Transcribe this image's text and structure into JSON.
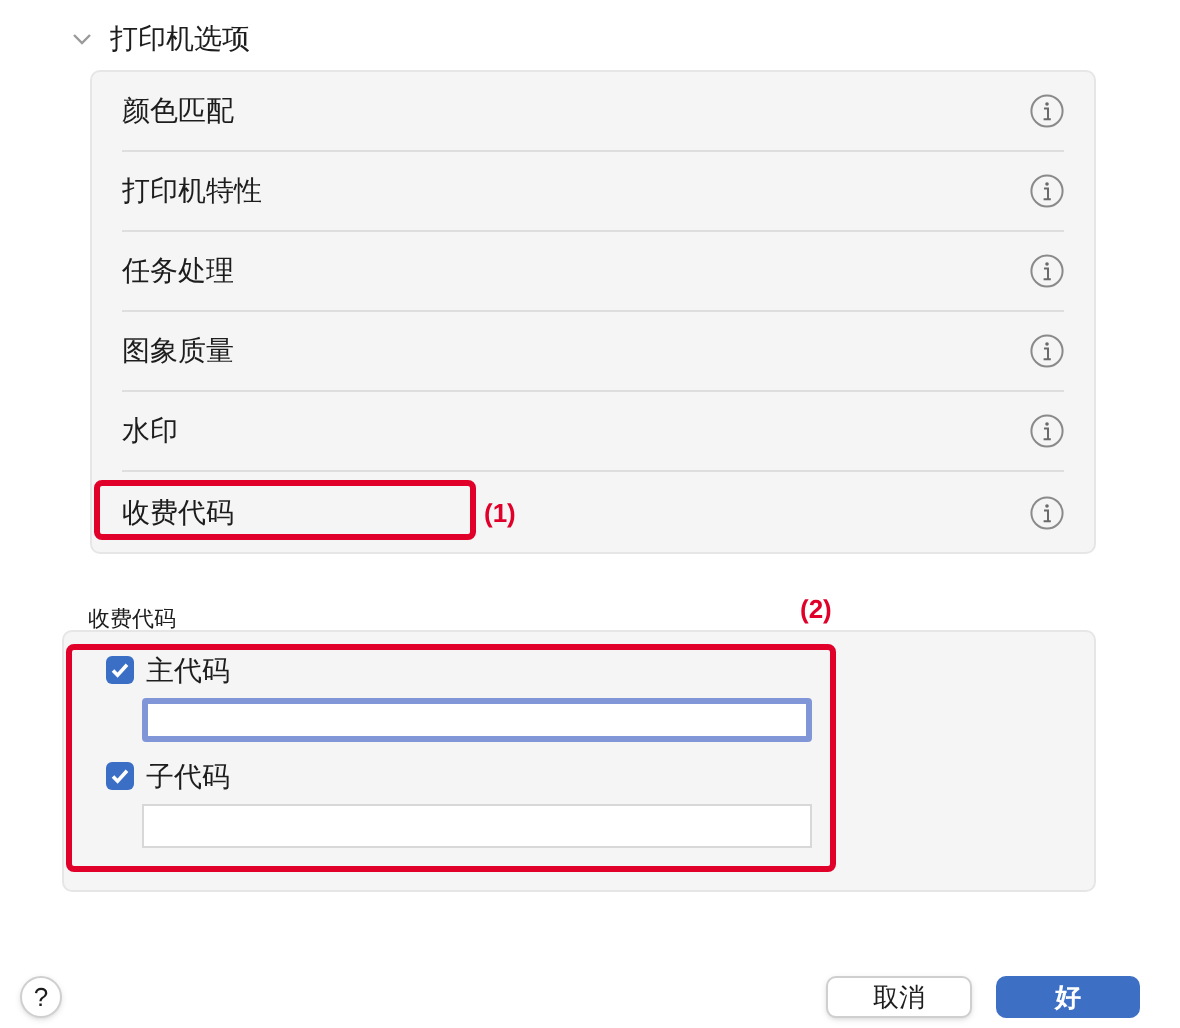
{
  "section": {
    "title": "打印机选项",
    "expanded": true
  },
  "options": [
    {
      "label": "颜色匹配",
      "annotated": false
    },
    {
      "label": "打印机特性",
      "annotated": false
    },
    {
      "label": "任务处理",
      "annotated": false
    },
    {
      "label": "图象质量",
      "annotated": false
    },
    {
      "label": "水印",
      "annotated": false
    },
    {
      "label": "收费代码",
      "annotated": true,
      "callout": "(1)"
    }
  ],
  "billing_codes": {
    "title": "收费代码",
    "annotated": true,
    "callout": "(2)",
    "fields": [
      {
        "label": "主代码",
        "checked": true,
        "focused": true
      },
      {
        "label": "子代码",
        "checked": true,
        "focused": false
      }
    ]
  },
  "buttons": {
    "help": "?",
    "cancel": "取消",
    "ok": "好"
  }
}
